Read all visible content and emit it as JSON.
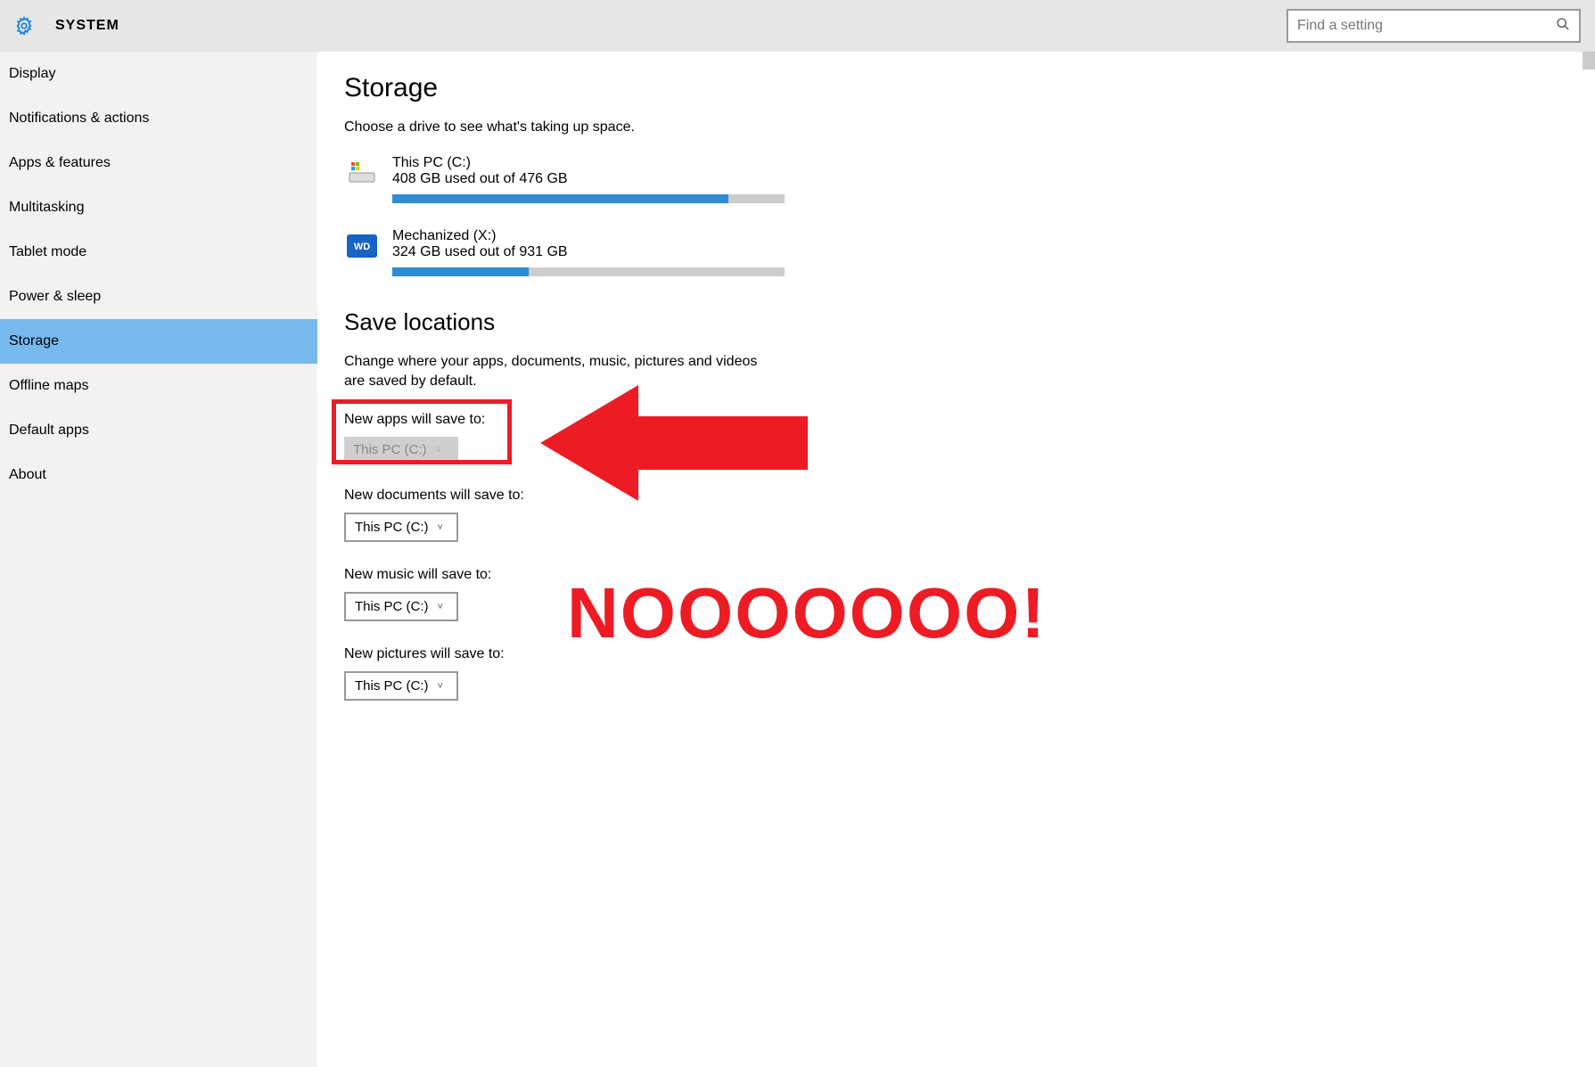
{
  "header": {
    "title": "SYSTEM",
    "search_placeholder": "Find a setting"
  },
  "sidebar": {
    "items": [
      {
        "label": "Display"
      },
      {
        "label": "Notifications & actions"
      },
      {
        "label": "Apps & features"
      },
      {
        "label": "Multitasking"
      },
      {
        "label": "Tablet mode"
      },
      {
        "label": "Power & sleep"
      },
      {
        "label": "Storage",
        "selected": true
      },
      {
        "label": "Offline maps"
      },
      {
        "label": "Default apps"
      },
      {
        "label": "About"
      }
    ]
  },
  "storage": {
    "title": "Storage",
    "desc": "Choose a drive to see what's taking up space.",
    "drives": [
      {
        "name": "This PC (C:)",
        "used_gb": 408,
        "total_gb": 476,
        "usage_text": "408 GB used out of 476 GB",
        "icon": "win-drive"
      },
      {
        "name": "Mechanized (X:)",
        "used_gb": 324,
        "total_gb": 931,
        "usage_text": "324 GB used out of 931 GB",
        "icon": "wd-drive"
      }
    ]
  },
  "save_locations": {
    "title": "Save locations",
    "desc": "Change where your apps, documents, music, pictures and videos are saved by default.",
    "items": [
      {
        "label": "New apps will save to:",
        "value": "This PC (C:)",
        "disabled": true
      },
      {
        "label": "New documents will save to:",
        "value": "This PC (C:)",
        "disabled": false
      },
      {
        "label": "New music will save to:",
        "value": "This PC (C:)",
        "disabled": false
      },
      {
        "label": "New pictures will save to:",
        "value": "This PC (C:)",
        "disabled": false
      }
    ]
  },
  "annotation": {
    "text": "NOOOOOOO!"
  },
  "colors": {
    "accent": "#2e8cd6",
    "highlight": "#ed1c24",
    "sidebar_selected": "#76b9ed"
  }
}
